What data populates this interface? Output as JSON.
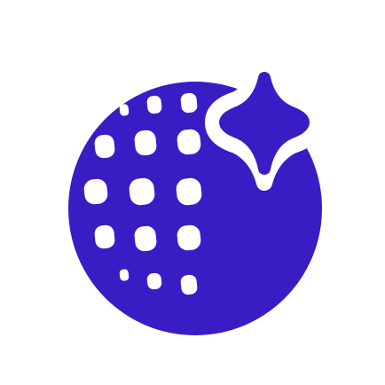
{
  "logo": {
    "name": "disco-ball-sparkle-logo",
    "icon": "disco-ball-icon",
    "sparkle_icon": "sparkle-icon",
    "colors": {
      "primary": "#3A1CC5",
      "background": "#FFFFFF"
    }
  }
}
